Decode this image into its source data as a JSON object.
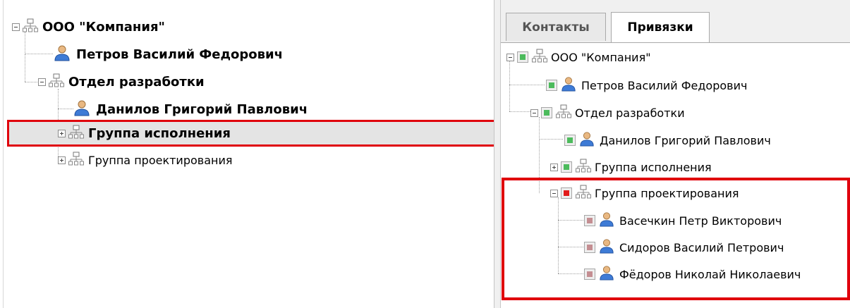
{
  "left_tree": {
    "root": "ООО \"Компания\"",
    "items": [
      {
        "label": "Петров Василий Федорович",
        "type": "person"
      },
      {
        "label": "Отдел разработки",
        "type": "org"
      },
      {
        "label": "Данилов Григорий Павлович",
        "type": "person"
      },
      {
        "label": "Группа исполнения",
        "type": "org",
        "selected": true
      },
      {
        "label": "Группа проектирования",
        "type": "org"
      }
    ]
  },
  "tabs": [
    {
      "label": "Контакты",
      "active": false
    },
    {
      "label": "Привязки",
      "active": true
    }
  ],
  "right_tree": {
    "root": "ООО \"Компания\"",
    "items": [
      {
        "label": "Петров Василий Федорович",
        "check": "green"
      },
      {
        "label": "Отдел разработки",
        "check": "green"
      },
      {
        "label": "Данилов Григорий Павлович",
        "check": "green"
      },
      {
        "label": "Группа исполнения",
        "check": "green"
      },
      {
        "label": "Группа проектирования",
        "check": "red"
      },
      {
        "label": "Васечкин Петр Викторович",
        "check": "pink"
      },
      {
        "label": "Сидоров Василий Петрович",
        "check": "pink"
      },
      {
        "label": "Фёдоров Николай Николаевич",
        "check": "pink"
      }
    ]
  },
  "colors": {
    "highlight": "#e0000c",
    "check_green": "#4cbb5c",
    "check_red": "#e21b1b",
    "check_pink": "#c48e92",
    "selection_bg": "#e4e4e4"
  }
}
